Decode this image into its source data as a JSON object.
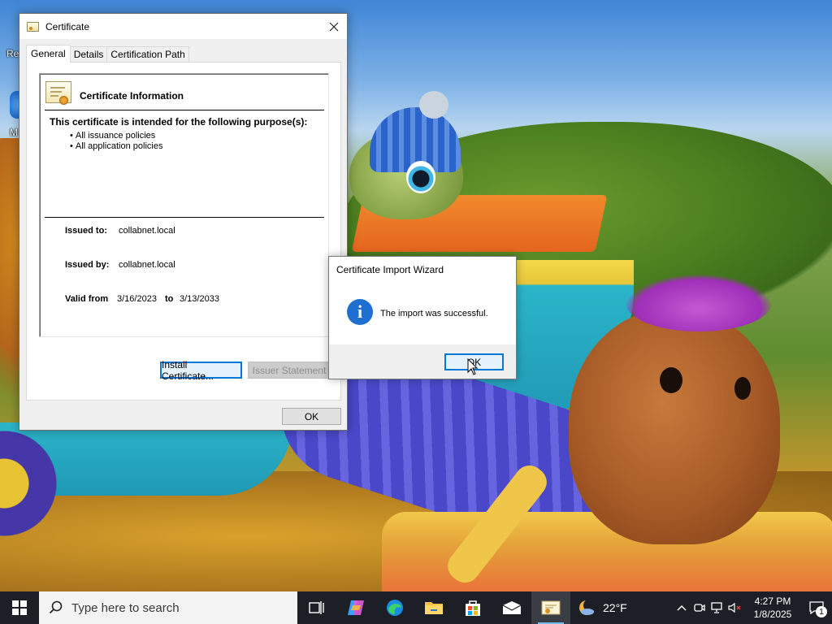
{
  "desktop": {
    "icon1_label": "Re",
    "icon2_label": "M"
  },
  "certificate_window": {
    "title": "Certificate",
    "tabs": [
      {
        "label": "General",
        "active": true
      },
      {
        "label": "Details",
        "active": false
      },
      {
        "label": "Certification Path",
        "active": false
      }
    ],
    "info_title": "Certificate Information",
    "purpose_heading": "This certificate is intended for the following purpose(s):",
    "purposes": [
      "All issuance policies",
      "All application policies"
    ],
    "issued_to_label": "Issued to:",
    "issued_to_value": "collabnet.local",
    "issued_by_label": "Issued by:",
    "issued_by_value": "collabnet.local",
    "valid_from_label": "Valid from",
    "valid_from_value": "3/16/2023",
    "valid_to_label": "to",
    "valid_to_value": "3/13/2033",
    "install_button": "Install Certificate...",
    "issuer_statement_button": "Issuer Statement",
    "ok_button": "OK"
  },
  "wizard_dialog": {
    "title": "Certificate Import Wizard",
    "icon": "information-icon",
    "message": "The import was successful.",
    "ok_button": "OK"
  },
  "taskbar": {
    "search_placeholder": "Type here to search",
    "apps": [
      "task-view-icon",
      "copilot-icon",
      "edge-icon",
      "file-explorer-icon",
      "store-icon",
      "mail-icon",
      "certificate-app-icon"
    ],
    "weather_temp": "22°F",
    "clock_time": "4:27 PM",
    "clock_date": "1/8/2025",
    "notification_count": "1"
  },
  "colors": {
    "accent": "#0078d7",
    "taskbar_bg": "#1c1f26",
    "info_icon": "#1f6fd1"
  }
}
